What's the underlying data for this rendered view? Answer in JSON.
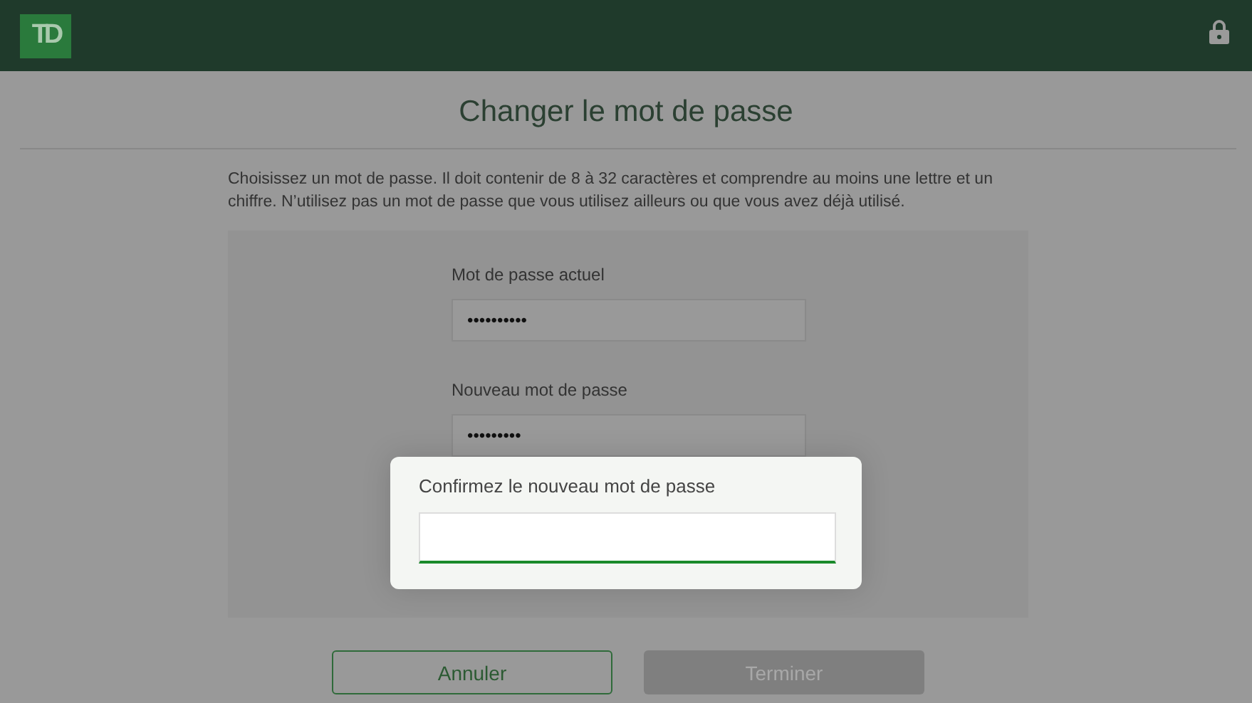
{
  "header": {
    "logo": "TD"
  },
  "title": "Changer le mot de passe",
  "instructions": "Choisissez un mot de passe. Il doit contenir de 8 à 32 caractères et comprendre au moins une lettre et un chiffre. N’utilisez pas un mot de passe que vous utilisez ailleurs ou que vous avez déjà utilisé.",
  "fields": [
    {
      "label": "Mot de passe actuel",
      "value": "••••••••••"
    },
    {
      "label": "Nouveau mot de passe",
      "value": "•••••••••"
    }
  ],
  "focused_field": {
    "label": "Confirmez le nouveau mot de passe",
    "focused": true
  },
  "buttons": [
    {
      "label": "Annuler",
      "kind": "secondary",
      "disabled": false
    },
    {
      "label": "Terminer",
      "kind": "primary",
      "disabled": true
    }
  ]
}
